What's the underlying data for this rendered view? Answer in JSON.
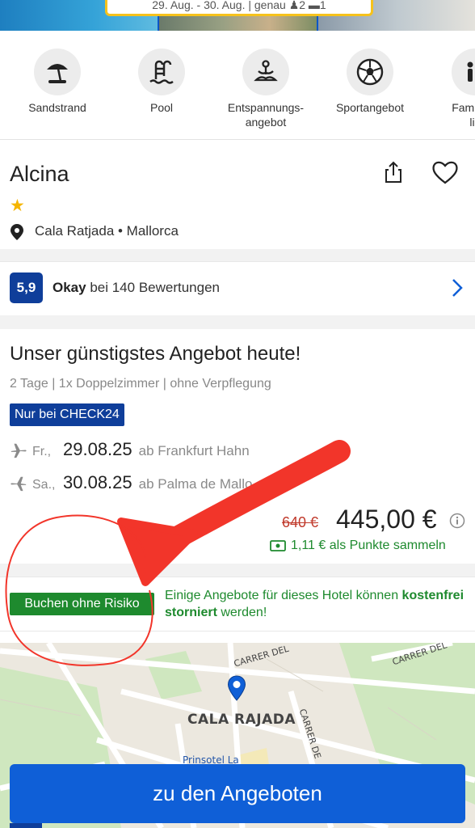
{
  "header": {
    "search_summary": "29. Aug. - 30. Aug. | genau ♟2 ▬1"
  },
  "amenities": [
    {
      "label": "Sandstrand",
      "icon": "beach-umbrella-icon"
    },
    {
      "label": "Pool",
      "icon": "pool-ladder-icon"
    },
    {
      "label": "Entspannungs-\nangebot",
      "icon": "meditation-icon"
    },
    {
      "label": "Sportangebot",
      "icon": "soccer-ball-icon"
    },
    {
      "label": "Familien-\nlic",
      "icon": "family-icon"
    }
  ],
  "hotel": {
    "name": "Alcina",
    "stars": "★",
    "location": "Cala Ratjada • Mallorca"
  },
  "rating": {
    "score": "5,9",
    "label": "Okay",
    "reviews": " bei 140 Bewertungen"
  },
  "offer": {
    "title": "Unser günstigstes Angebot heute!",
    "subtitle": "2 Tage | 1x Doppelzimmer | ohne Verpflegung",
    "badge": "Nur bei CHECK24",
    "flights": [
      {
        "day": "Fr.,",
        "date": "29.08.25",
        "airport": "ab Frankfurt Hahn"
      },
      {
        "day": "Sa.,",
        "date": "30.08.25",
        "airport": "ab Palma de Mallo"
      }
    ],
    "old_price": "640 €",
    "price": "445,00 €",
    "points": "1,11 € als Punkte sammeln"
  },
  "risk": {
    "badge": "Buchen ohne Risiko",
    "text_prefix": "Einige Angebote für dieses Hotel können ",
    "text_bold": "kostenfrei storniert",
    "text_suffix": " werden!"
  },
  "map": {
    "town": "CALA RAJADA",
    "street1": "CARRER DEL",
    "street2": "CARRER DEL",
    "street3": "CARRER DE",
    "poi": "Prinsotel La"
  },
  "cta": {
    "label": "zu den Angeboten"
  },
  "colors": {
    "brand_blue": "#0f3e9a",
    "cta_blue": "#0f5fd7",
    "green": "#1e8a2e",
    "old_price_red": "#c0392b",
    "star_yellow": "#f5b500",
    "annotation_red": "#f2352a"
  }
}
